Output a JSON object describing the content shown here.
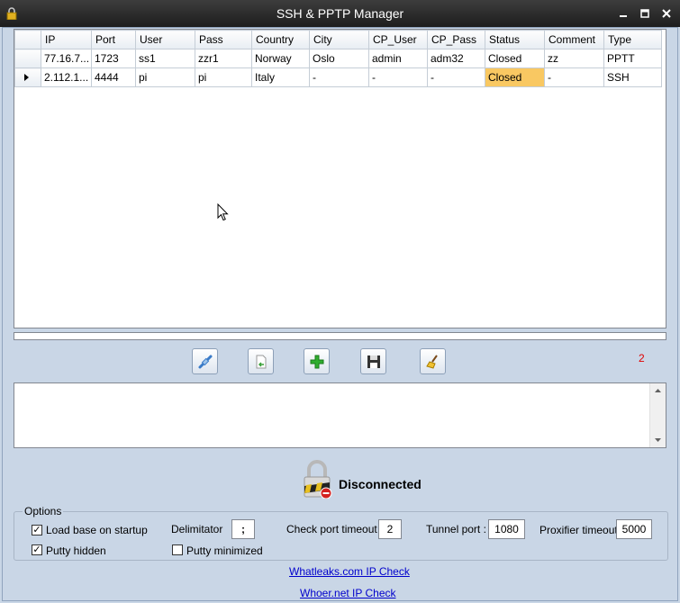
{
  "window": {
    "title": "SSH & PPTP Manager"
  },
  "grid": {
    "columns": [
      "IP",
      "Port",
      "User",
      "Pass",
      "Country",
      "City",
      "CP_User",
      "CP_Pass",
      "Status",
      "Comment",
      "Type"
    ],
    "rows": [
      [
        "77.16.7...",
        "1723",
        "ss1",
        "zzr1",
        "Norway",
        "Oslo",
        "admin",
        "adm32",
        "Closed",
        "zz",
        "PPTT"
      ],
      [
        "2.112.1...",
        "4444",
        "pi",
        "pi",
        "Italy",
        "-",
        "-",
        "-",
        "Closed",
        "-",
        "SSH"
      ]
    ]
  },
  "toolbar": {
    "buttons": [
      "connect-icon",
      "import-icon",
      "add-icon",
      "save-icon",
      "clear-icon"
    ]
  },
  "counter": "2",
  "status": {
    "text": "Disconnected"
  },
  "options": {
    "legend": "Options",
    "load_base": "Load base on startup",
    "putty_hidden": "Putty hidden",
    "delimitator_label": "Delimitator",
    "delimitator_value": ";",
    "putty_minimized": "Putty minimized",
    "check_port_label": "Check port timeout :",
    "check_port_value": "2",
    "tunnel_port_label": "Tunnel port :",
    "tunnel_port_value": "1080",
    "proxifier_label": "Proxifier timeout :",
    "proxifier_value": "5000"
  },
  "links": {
    "whatleaks": "Whatleaks.com IP Check",
    "whoer": "Whoer.net IP Check"
  },
  "colors": {
    "selected_cell": "#f9c862",
    "counter": "#e00000",
    "link": "#0000cc"
  }
}
